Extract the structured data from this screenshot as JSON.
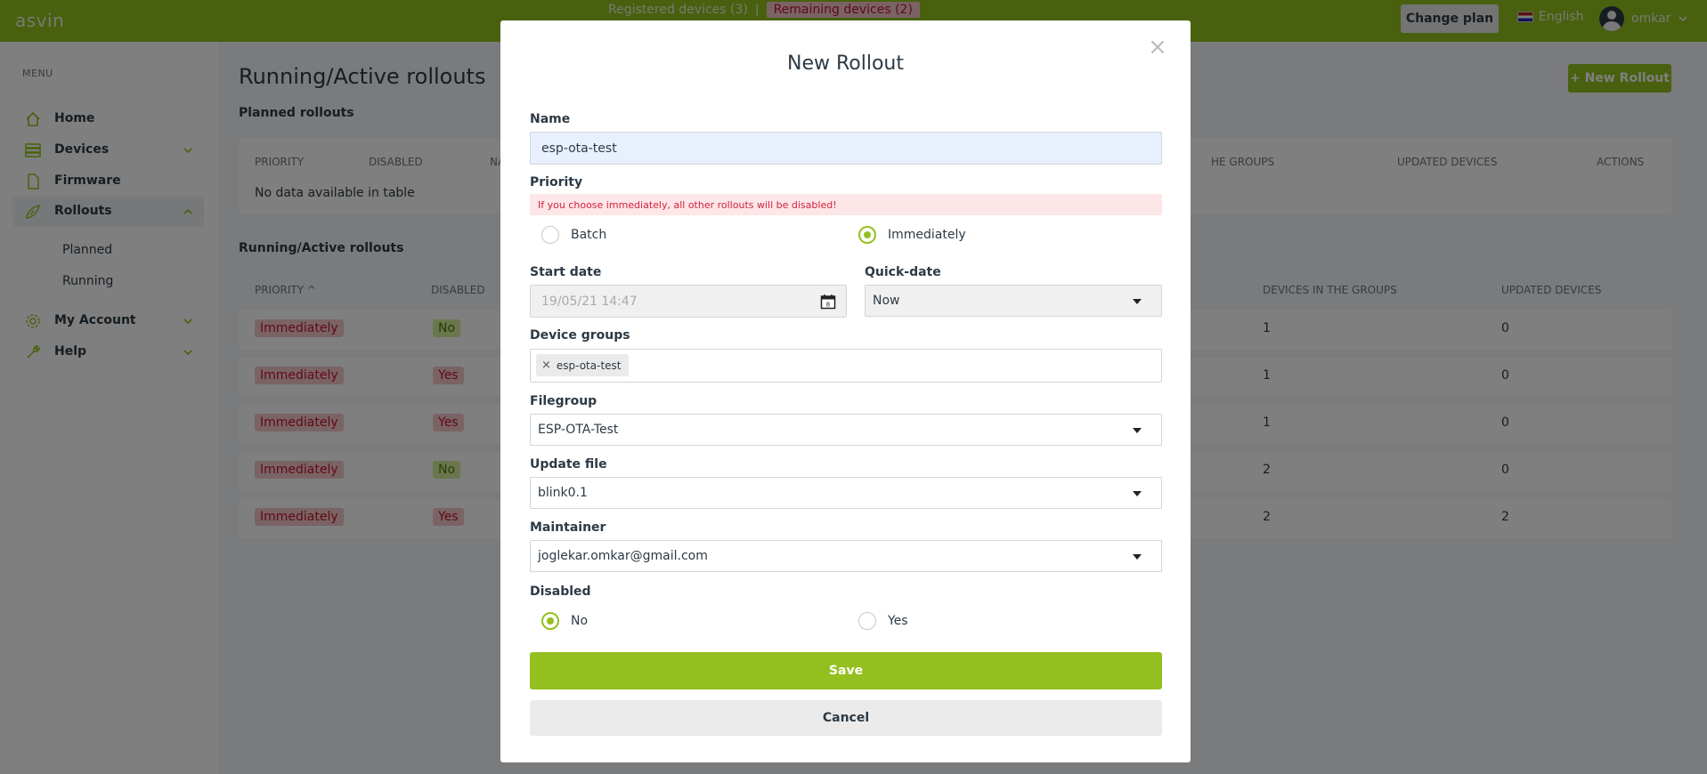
{
  "topbar": {
    "brand": "asvin",
    "tab_registered": "Registered devices (3)",
    "tab_separator": "|",
    "tab_remaining": "Remaining devices (2)",
    "change_plan": "Change plan",
    "language": "English",
    "username": "omkar"
  },
  "sidebar": {
    "menu_label": "MENU",
    "items": [
      {
        "label": "Home",
        "icon": "home-icon"
      },
      {
        "label": "Devices",
        "icon": "devices-icon"
      },
      {
        "label": "Firmware",
        "icon": "file-icon"
      },
      {
        "label": "Rollouts",
        "icon": "rollouts-icon"
      },
      {
        "label": "My Account",
        "icon": "gear-icon"
      },
      {
        "label": "Help",
        "icon": "wrench-icon"
      }
    ],
    "sub_items": [
      "Planned",
      "Running"
    ]
  },
  "main": {
    "page_title": "Running/Active rollouts",
    "new_rollout": "+ New Rollout",
    "planned": {
      "title": "Planned rollouts",
      "headers": [
        "PRIORITY",
        "DISABLED",
        "NA",
        "HE GROUPS",
        "UPDATED DEVICES",
        "ACTIONS"
      ],
      "empty": "No data available in table"
    },
    "running": {
      "title": "Running/Active rollouts",
      "headers": [
        "PRIORITY",
        "DISABLED",
        "DEVICES IN THE GROUPS",
        "UPDATED DEVICES"
      ],
      "sort_glyph": "^",
      "rows": [
        {
          "priority": "Immediately",
          "disabled": "No",
          "devices": "1",
          "updated": "0"
        },
        {
          "priority": "Immediately",
          "disabled": "Yes",
          "devices": "1",
          "updated": "0"
        },
        {
          "priority": "Immediately",
          "disabled": "Yes",
          "devices": "1",
          "updated": "0"
        },
        {
          "priority": "Immediately",
          "disabled": "No",
          "devices": "2",
          "updated": "0"
        },
        {
          "priority": "Immediately",
          "disabled": "Yes",
          "devices": "2",
          "updated": "2"
        }
      ]
    }
  },
  "modal": {
    "close": "×",
    "title": "New Rollout",
    "name_label": "Name",
    "name_value": "esp-ota-test",
    "priority_label": "Priority",
    "warning": "If you choose immediately, all other rollouts will be disabled!",
    "priority_batch": "Batch",
    "priority_immediately": "Immediately",
    "priority_selected": "Immediately",
    "start_date_label": "Start date",
    "start_date_value": "19/05/21 14:47",
    "calendar_day": "8",
    "quick_date_label": "Quick-date",
    "quick_date_value": "Now",
    "device_groups_label": "Device groups",
    "device_group_chip": "esp-ota-test",
    "chip_remove": "×",
    "filegroup_label": "Filegroup",
    "filegroup_value": "ESP-OTA-Test",
    "update_file_label": "Update file",
    "update_file_value": "blink0.1",
    "maintainer_label": "Maintainer",
    "maintainer_value": "joglekar.omkar@gmail.com",
    "disabled_label": "Disabled",
    "disabled_no": "No",
    "disabled_yes": "Yes",
    "disabled_selected": "No",
    "save": "Save",
    "cancel": "Cancel"
  },
  "colors": {
    "brand_green": "#93c01f",
    "danger_red": "#c0152d",
    "danger_bg": "#f5c6cb"
  }
}
